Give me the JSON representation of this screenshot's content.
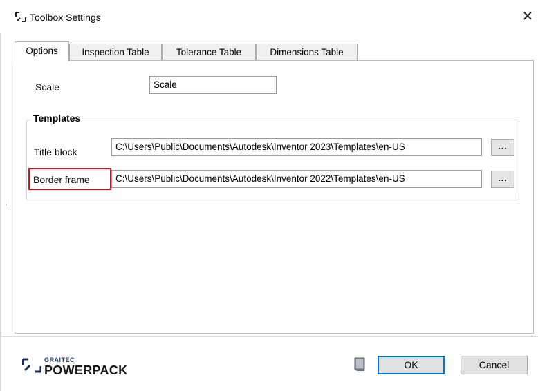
{
  "window": {
    "title": "Toolbox Settings",
    "close_label": "✕"
  },
  "tabs": [
    {
      "label": "Options",
      "active": true
    },
    {
      "label": "Inspection Table",
      "active": false
    },
    {
      "label": "Tolerance Table",
      "active": false
    },
    {
      "label": "Dimensions Table",
      "active": false
    }
  ],
  "options": {
    "scale_label": "Scale",
    "scale_value": "Scale",
    "templates_legend": "Templates",
    "title_block_label": "Title block",
    "title_block_value": "C:\\Users\\Public\\Documents\\Autodesk\\Inventor 2023\\Templates\\en-US",
    "border_frame_label": "Border frame",
    "border_frame_value": "C:\\Users\\Public\\Documents\\Autodesk\\Inventor 2022\\Templates\\en-US",
    "browse_label": "..."
  },
  "footer": {
    "logo_small": "GRAITEC",
    "logo_big": "POWERPACK",
    "ok_label": "OK",
    "cancel_label": "Cancel",
    "help_icon": "book-help-icon"
  },
  "colors": {
    "highlight": "#d4111f",
    "ok_border": "#0078d7",
    "logo_blue": "#2a3a66"
  }
}
